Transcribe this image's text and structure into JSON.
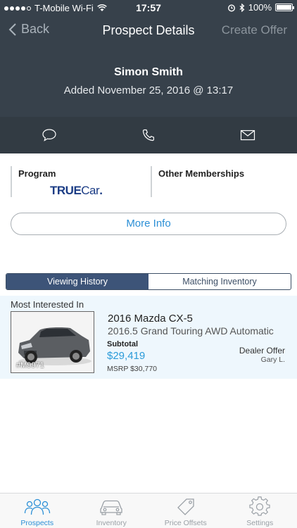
{
  "status_bar": {
    "carrier": "T-Mobile Wi-Fi",
    "time": "17:57",
    "battery": "100%",
    "battery_level": 1.0
  },
  "nav": {
    "back_label": "Back",
    "title": "Prospect Details",
    "action_label": "Create Offer"
  },
  "prospect": {
    "name": "Simon Smith",
    "added": "Added November 25, 2016 @ 13:17"
  },
  "contact_actions": [
    {
      "icon": "chat-bubble-icon"
    },
    {
      "icon": "phone-icon"
    },
    {
      "icon": "envelope-icon"
    }
  ],
  "program": {
    "label": "Program",
    "logo_text_true": "TRUE",
    "logo_text_car": "Car",
    "logo_mark": ".",
    "other_label": "Other Memberships"
  },
  "more_info_label": "More Info",
  "tabs": {
    "viewing_history": "Viewing History",
    "matching_inventory": "Matching Inventory",
    "active": "viewing_history"
  },
  "interested": {
    "section_label": "Most Interested In",
    "stock": "#M9971",
    "title": "2016 Mazda CX-5",
    "trim": "2016.5 Grand Touring AWD Automatic",
    "subtotal_label": "Subtotal",
    "subtotal": "$29,419",
    "msrp": "MSRP $30,770",
    "offer_label": "Dealer Offer",
    "offer_person": "Gary L."
  },
  "tabbar": {
    "items": [
      {
        "label": "Prospects",
        "icon": "people-icon",
        "active": true
      },
      {
        "label": "Inventory",
        "icon": "car-icon",
        "active": false
      },
      {
        "label": "Price Offsets",
        "icon": "tag-icon",
        "active": false
      },
      {
        "label": "Settings",
        "icon": "gear-icon",
        "active": false
      }
    ]
  },
  "colors": {
    "header_bg": "#37414b",
    "accent": "#2b8fd6",
    "tab_active": "#3d5478",
    "card_bg": "#eef7fd"
  }
}
